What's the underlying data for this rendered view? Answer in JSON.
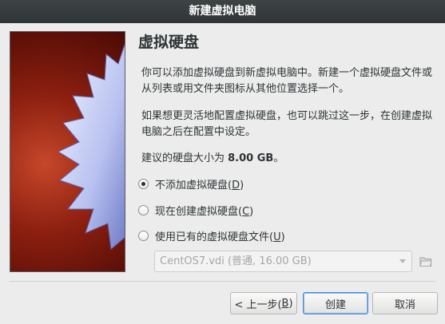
{
  "window": {
    "title": "新建虚拟电脑"
  },
  "page": {
    "title": "虚拟硬盘",
    "paragraph1": "你可以添加虚拟硬盘到新虚拟电脑中。新建一个虚拟硬盘文件或从列表或用文件夹图标从其他位置选择一个。",
    "paragraph2": "如果想更灵活地配置虚拟硬盘，也可以跳过这一步，在创建虚拟电脑之后在配置中设定。",
    "recommended_prefix": "建议的硬盘大小为 ",
    "recommended_size": "8.00 GB",
    "recommended_suffix": "。"
  },
  "options": [
    {
      "label_main": "不添加虚拟硬盘(",
      "mnemonic": "D",
      "label_end": ")",
      "selected": true
    },
    {
      "label_main": "现在创建虚拟硬盘(",
      "mnemonic": "C",
      "label_end": ")",
      "selected": false
    },
    {
      "label_main": "使用已有的虚拟硬盘文件(",
      "mnemonic": "U",
      "label_end": ")",
      "selected": false
    }
  ],
  "disk_select": {
    "value": "CentOS7.vdi (普通, 16.00 GB)",
    "enabled": false
  },
  "buttons": {
    "back_main": "< 上一步(",
    "back_mnemonic": "B",
    "back_end": ")",
    "create": "创建",
    "cancel": "取消"
  },
  "colors": {
    "accent": "#4a90d9",
    "titlebar": "#2f3436",
    "wizard_bg": "#8c1f10"
  },
  "icons": {
    "folder": "folder-open-icon",
    "dropdown": "chevron-down-icon"
  }
}
